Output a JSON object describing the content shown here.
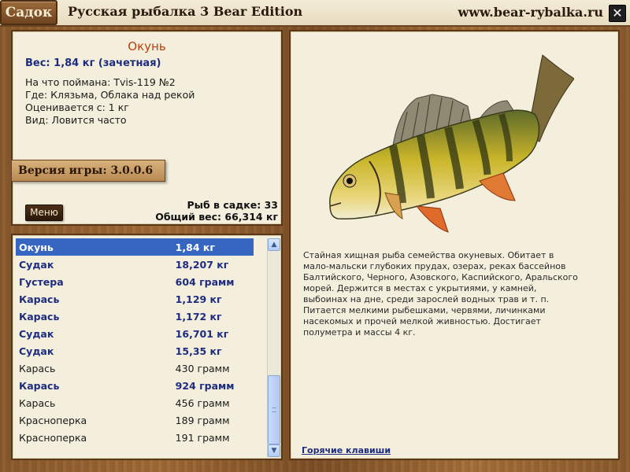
{
  "titlebar": {
    "tab_label": "Садок",
    "app_title": "Русская рыбалка 3 Bear Edition",
    "site_url": "www.bear-rybalka.ru",
    "close_glyph": "✕"
  },
  "info": {
    "fish_name": "Окунь",
    "weight_line": "Вес: 1,84 кг (зачетная)",
    "caught_with_label": "На что поймана:",
    "caught_with_value": "Tvis-119 №2",
    "where_label": "Где:",
    "where_value": "Клязьма, Облака над рекой",
    "valued_from_label": "Оценивается с:",
    "valued_from_value": "1 кг",
    "kind_label": "Вид:",
    "kind_value": "Ловится часто",
    "version": "Версия игры: 3.0.0.6",
    "menu_label": "Меню",
    "fish_count_label": "Рыб в садке:",
    "fish_count_value": "33",
    "total_weight_label": "Общий вес:",
    "total_weight_value": "66,314 кг"
  },
  "list": {
    "rows": [
      {
        "name": "Окунь",
        "weight": "1,84 кг"
      },
      {
        "name": "Судак",
        "weight": "18,207 кг"
      },
      {
        "name": "Густера",
        "weight": "604 грамм"
      },
      {
        "name": "Карась",
        "weight": "1,129 кг"
      },
      {
        "name": "Карась",
        "weight": "1,172 кг"
      },
      {
        "name": "Судак",
        "weight": "16,701 кг"
      },
      {
        "name": "Судак",
        "weight": "15,35 кг"
      },
      {
        "name": "Карась",
        "weight": "430 грамм"
      },
      {
        "name": "Карась",
        "weight": "924 грамм"
      },
      {
        "name": "Карась",
        "weight": "456 грамм"
      },
      {
        "name": "Красноперка",
        "weight": "189 грамм"
      },
      {
        "name": "Красноперка",
        "weight": "191 грамм"
      }
    ],
    "scroll_up_glyph": "▲",
    "scroll_down_glyph": "▼"
  },
  "detail": {
    "description": "Стайная хищная рыба семейства окуневых. Обитает в мало-мальски глубоких прудах, озерах, реках бассейнов Балтийского, Черного, Азовского, Каспийского, Аральского морей. Держится в местах с укрытиями, у камней, выбоинах на дне, среди зарослей водных трав и т. п. Питается мелкими рыбешками, червями, личинками насекомых и прочей мелкой живностью. Достигает полуметра и массы 4 кг.",
    "hotkeys_link": "Горячие клавиши",
    "image_icon": "perch-fish-illustration"
  },
  "colors": {
    "accent_blue": "#1e2c80",
    "selection": "#3466c2",
    "fish_name": "#b8400e",
    "wood": "#8a5a2c"
  }
}
